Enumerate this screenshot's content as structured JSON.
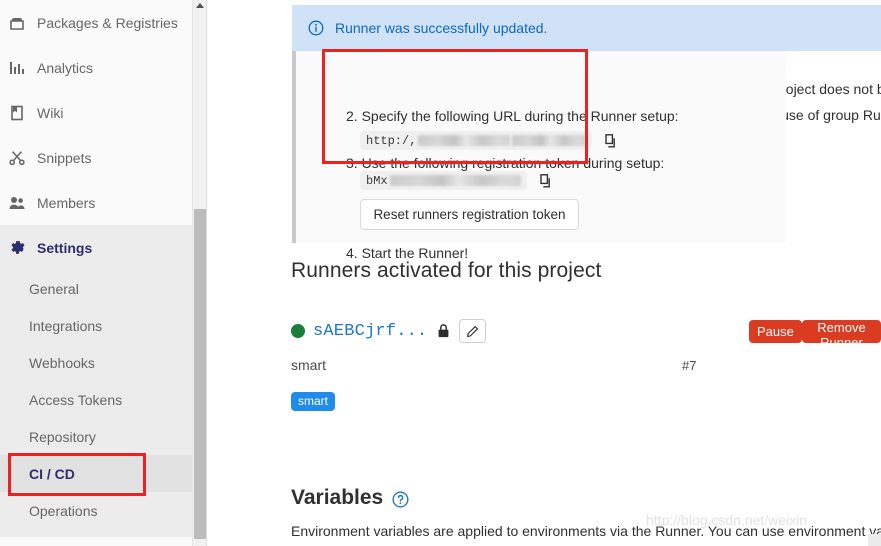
{
  "sidebar": {
    "items": [
      {
        "label": "Packages & Registries",
        "icon": "package-icon",
        "active": false
      },
      {
        "label": "Analytics",
        "icon": "analytics-icon",
        "active": false
      },
      {
        "label": "Wiki",
        "icon": "wiki-icon",
        "active": false
      },
      {
        "label": "Snippets",
        "icon": "snippets-icon",
        "active": false
      },
      {
        "label": "Members",
        "icon": "members-icon",
        "active": false
      },
      {
        "label": "Settings",
        "icon": "gear-icon",
        "active": true
      }
    ],
    "subitems": [
      {
        "label": "General",
        "active": false
      },
      {
        "label": "Integrations",
        "active": false
      },
      {
        "label": "Webhooks",
        "active": false
      },
      {
        "label": "Access Tokens",
        "active": false
      },
      {
        "label": "Repository",
        "active": false
      },
      {
        "label": "CI / CD",
        "active": true
      },
      {
        "label": "Operations",
        "active": false
      }
    ]
  },
  "alert": {
    "icon": "info-circle-icon",
    "message": "Runner was successfully updated.",
    "background": "#cfe2f7",
    "text_color": "#1068bf"
  },
  "setup": {
    "step2": "2. Specify the following URL during the Runner setup:",
    "url_prefix": "http:/,",
    "url_redacted": true,
    "copy_url_icon": "copy-icon",
    "step3": "3. Use the following registration token during setup:",
    "token_prefix": "bMx",
    "token_redacted": true,
    "copy_token_icon": "copy-icon",
    "reset_button": "Reset runners registration token",
    "step4": "4. Start the Runner!"
  },
  "right_panel": {
    "text": "This project does not be\nmake use of group Runn",
    "accent_color": "#e4c98a"
  },
  "runners": {
    "heading": "Runners activated for this project",
    "entry": {
      "status": "online",
      "status_color": "#1a7f37",
      "name": "sAEBCjrf...",
      "lock_icon": "lock-icon",
      "edit_icon": "pencil-icon",
      "pause_label": "Pause",
      "remove_label": "Remove Runner",
      "button_color": "#db3b21",
      "description": "smart",
      "id": "#7",
      "tag": "smart",
      "tag_color": "#1f8ceb"
    }
  },
  "variables": {
    "heading": "Variables",
    "help_icon": "question-circle-icon",
    "description": "Environment variables are applied to environments via the Runner. You can use environment var"
  },
  "watermark": {
    "text": "http://blog.csdn.net/weixin"
  },
  "annotations": {
    "accent_color": "#ef2020",
    "boxes": [
      "setup-steps-highlight",
      "ci-cd-nav-highlight"
    ]
  }
}
